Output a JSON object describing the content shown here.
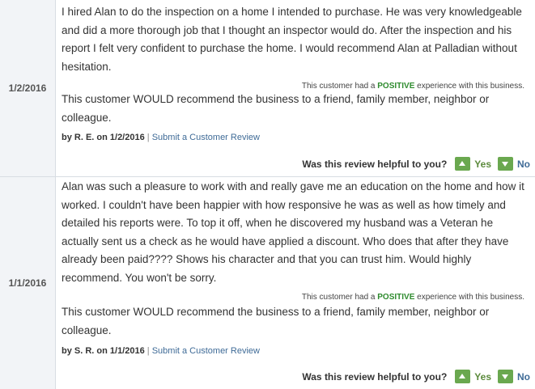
{
  "reviews": [
    {
      "date": "1/2/2016",
      "text": "I hired Alan to do the inspection on a home I intended to purchase. He was very knowledgeable and did a more thorough job that I thought an inspector would do. After the inspection and his report I felt very confident to purchase the home. I would recommend Alan at Palladian without hesitation.",
      "experience_prefix": "This customer had a ",
      "experience_word": "POSITIVE",
      "experience_suffix": " experience with this business.",
      "recommend": "This customer WOULD recommend the business to a friend, family member, neighbor or colleague.",
      "by_prefix": "by R. E.",
      "by_on": " on 1/2/2016 ",
      "separator": "|",
      "submit_link": "Submit a Customer Review",
      "helpful_q": "Was this review helpful to you?",
      "yes": "Yes",
      "no": "No"
    },
    {
      "date": "1/1/2016",
      "text": "Alan was such a pleasure to work with and really gave me an education on the home and how it worked. I couldn't have been happier with how responsive he was as well as how timely and detailed his reports were. To top it off, when he discovered my husband was a Veteran he actually sent us a check as he would have applied a discount. Who does that after they have already been paid???? Shows his character and that you can trust him. Would highly recommend. You won't be sorry.",
      "experience_prefix": "This customer had a ",
      "experience_word": "POSITIVE",
      "experience_suffix": " experience with this business.",
      "recommend": "This customer WOULD recommend the business to a friend, family member, neighbor or colleague.",
      "by_prefix": "by S. R.",
      "by_on": " on 1/1/2016 ",
      "separator": "|",
      "submit_link": "Submit a Customer Review",
      "helpful_q": "Was this review helpful to you?",
      "yes": "Yes",
      "no": "No"
    }
  ]
}
